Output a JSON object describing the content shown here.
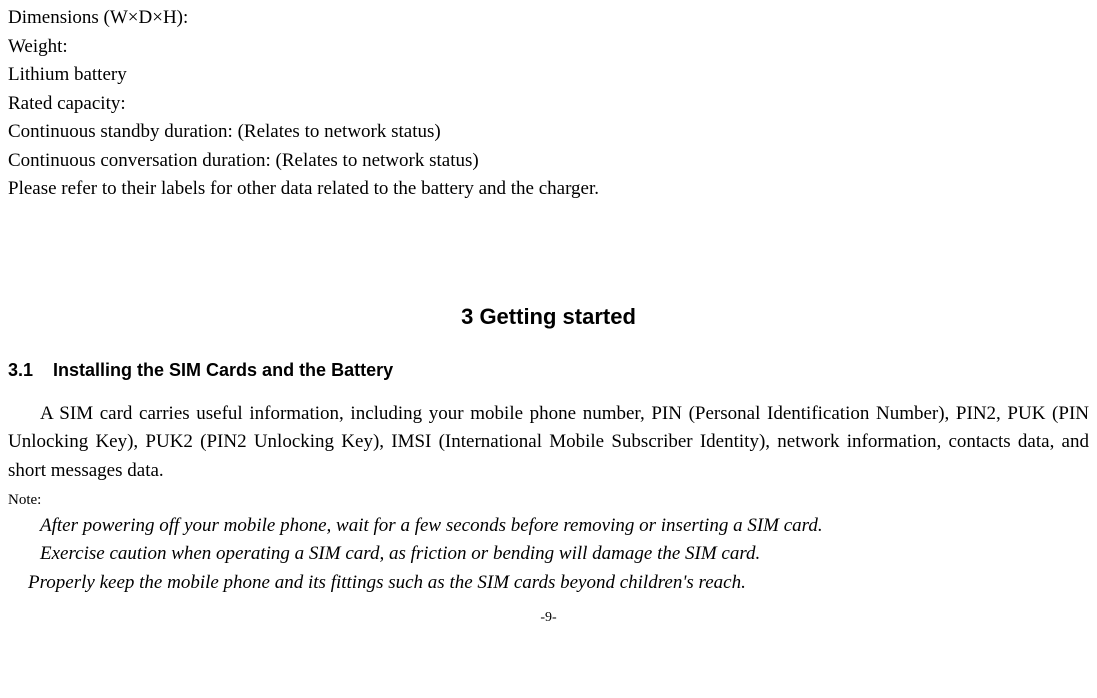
{
  "specs": {
    "l0": "Dimensions (W×D×H):",
    "l1": "Weight:",
    "l2": "Lithium battery",
    "l3": "Rated capacity:",
    "l4": "Continuous standby duration: (Relates to network status)",
    "l5": "Continuous conversation duration: (Relates to network status)",
    "l6": "Please refer to their labels for other data related to the battery and the charger."
  },
  "chapter": {
    "number": "3",
    "title": "Getting started",
    "full": "3  Getting started"
  },
  "section": {
    "number": "3.1",
    "title": "Installing the SIM Cards and the Battery"
  },
  "body": {
    "p1": "A SIM card carries useful information, including your mobile phone number, PIN (Personal Identification Number), PIN2, PUK (PIN Unlocking Key), PUK2 (PIN2 Unlocking Key), IMSI (International Mobile Subscriber Identity), network information, contacts data, and short messages data."
  },
  "note": {
    "label": "Note:",
    "n1": "After powering off your mobile phone, wait for a few seconds before removing or inserting a SIM card.",
    "n2": "Exercise caution when operating a SIM card, as friction or bending will damage the SIM card.",
    "n3": "Properly keep the mobile phone and its fittings such as the SIM cards beyond children's reach."
  },
  "page_number": "-9-"
}
